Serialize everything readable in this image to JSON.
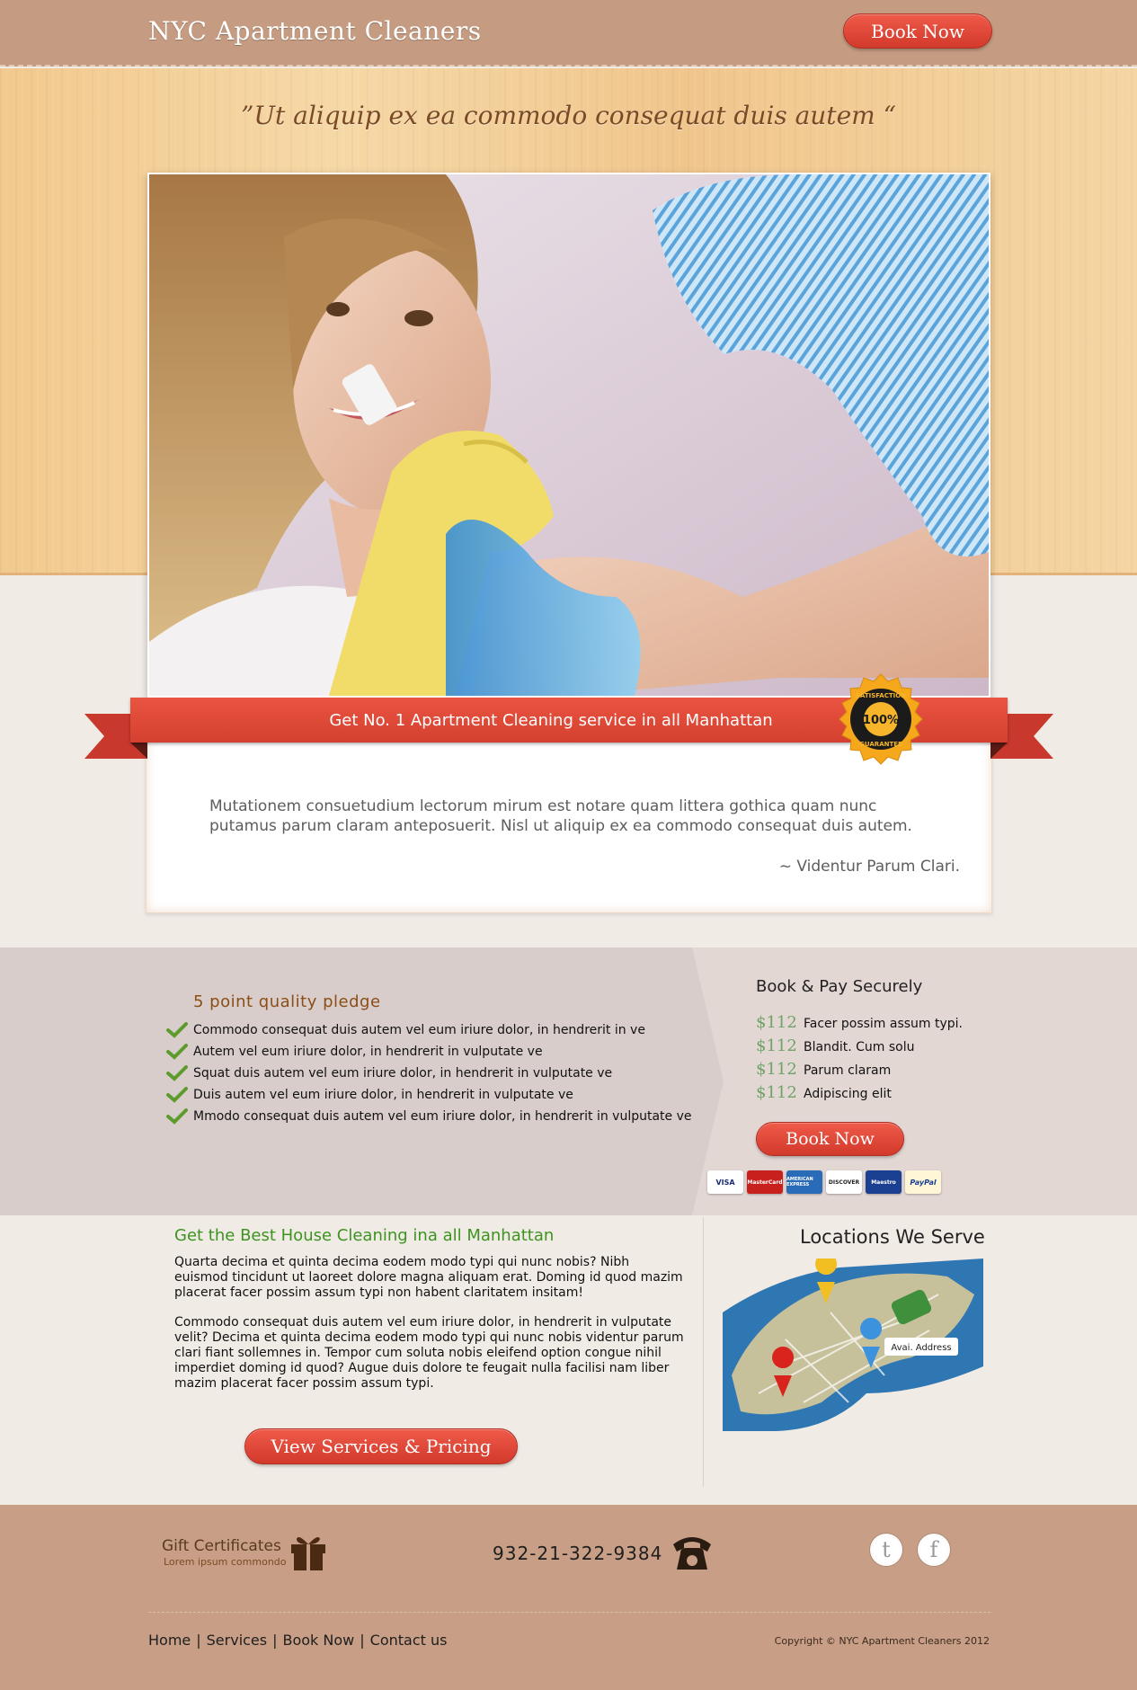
{
  "header": {
    "logo": "NYC Apartment Cleaners",
    "book_label": "Book Now"
  },
  "hero": {
    "tagline": "”Ut aliquip ex ea commodo consequat duis autem “"
  },
  "ribbon": {
    "text": "Get No. 1  Apartment Cleaning service in all Manhattan",
    "seal_top": "SATISFACTION",
    "seal_mid": "100%",
    "seal_bottom": "GUARANTEE"
  },
  "testimonial": {
    "quote": "Mutationem consuetudium lectorum mirum est notare quam littera gothica quam nunc putamus parum claram anteposuerit. Nisl ut aliquip ex ea commodo consequat duis autem.",
    "author": "~ Videntur Parum Clari."
  },
  "pledge": {
    "title": "5 point quality pledge",
    "items": [
      "Commodo consequat duis autem vel eum iriure dolor, in hendrerit in ve",
      "Autem vel eum iriure dolor, in hendrerit in vulputate ve",
      "Squat duis autem vel eum iriure dolor, in hendrerit in vulputate ve",
      "Duis autem vel eum iriure dolor, in hendrerit in vulputate ve",
      "Mmodo consequat duis autem vel eum iriure dolor, in hendrerit in vulputate ve"
    ]
  },
  "booking": {
    "title": "Book & Pay Securely",
    "prices": [
      {
        "price": "$112",
        "desc": "Facer possim assum typi."
      },
      {
        "price": "$112",
        "desc": "Blandit. Cum solu"
      },
      {
        "price": "$112",
        "desc": "Parum claram"
      },
      {
        "price": "$112",
        "desc": "Adipiscing elit"
      }
    ],
    "button": "Book Now",
    "cards": [
      "VISA",
      "MasterCard",
      "AMERICAN EXPRESS",
      "DISCOVER",
      "Maestro",
      "PayPal"
    ]
  },
  "content": {
    "title": "Get the Best House Cleaning ina all Manhattan",
    "p1": "Quarta decima et quinta decima eodem modo typi qui nunc nobis? Nibh euismod tincidunt ut laoreet dolore magna aliquam erat. Doming id quod mazim placerat facer possim assum typi non habent claritatem insitam!",
    "p2": "Commodo consequat duis autem vel eum iriure dolor, in hendrerit in vulputate velit? Decima et quinta decima eodem modo typi qui nunc nobis videntur parum clari fiant sollemnes in. Tempor cum soluta nobis eleifend option congue nihil imperdiet doming id quod? Augue duis dolore te feugait nulla facilisi nam liber mazim placerat facer possim assum typi.",
    "button": "View Services & Pricing"
  },
  "locations": {
    "title": "Locations We Serve",
    "map_label": "Avai. Address"
  },
  "footer": {
    "gift_title": "Gift Certificates",
    "gift_sub": "Lorem ipsum commondo",
    "phone": "932-21-322-9384",
    "twitter": "t",
    "facebook": "f",
    "nav": [
      "Home",
      "Services",
      "Book Now",
      "Contact us"
    ],
    "copyright": "Copyright © NYC Apartment Cleaners 2012"
  },
  "colors": {
    "accent_red": "#e04a3a",
    "header_brown": "#c59c82",
    "pledge_brown": "#8a4e16",
    "price_green": "#6fa36a",
    "title_green": "#3d9320"
  }
}
